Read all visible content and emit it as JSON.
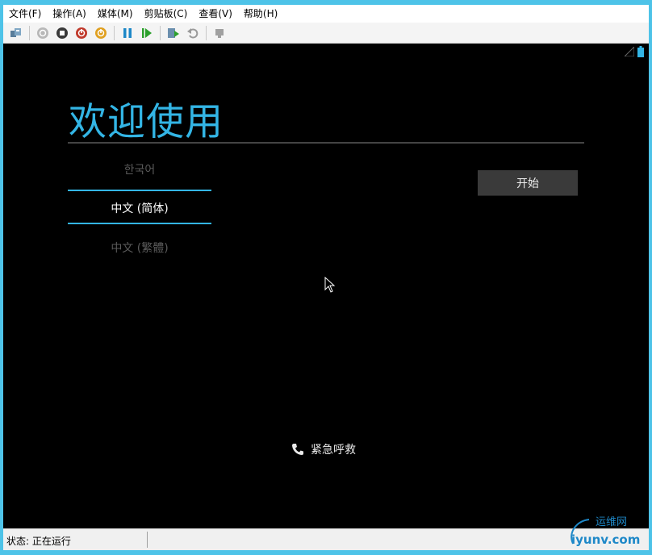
{
  "menu": {
    "items": [
      "文件(F)",
      "操作(A)",
      "媒体(M)",
      "剪贴板(C)",
      "查看(V)",
      "帮助(H)"
    ]
  },
  "toolbar": {
    "icons": [
      "ctrl-alt-del-icon",
      "start-icon",
      "turn-off-icon",
      "shutdown-icon",
      "power-icon",
      "pause-icon",
      "resume-icon",
      "checkpoint-icon",
      "revert-icon",
      "share-icon"
    ]
  },
  "screen": {
    "welcome_title": "欢迎使用",
    "languages": [
      {
        "label": "한국어",
        "selected": false
      },
      {
        "label": "中文 (简体)",
        "selected": true
      },
      {
        "label": "中文 (繁體)",
        "selected": false
      }
    ],
    "start_label": "开始",
    "emergency_label": "紧急呼救",
    "accent_color": "#33b5e5"
  },
  "status": {
    "text": "状态: 正在运行"
  },
  "watermark": {
    "text_top": "运维网",
    "text_bottom": "iyunv.com"
  }
}
